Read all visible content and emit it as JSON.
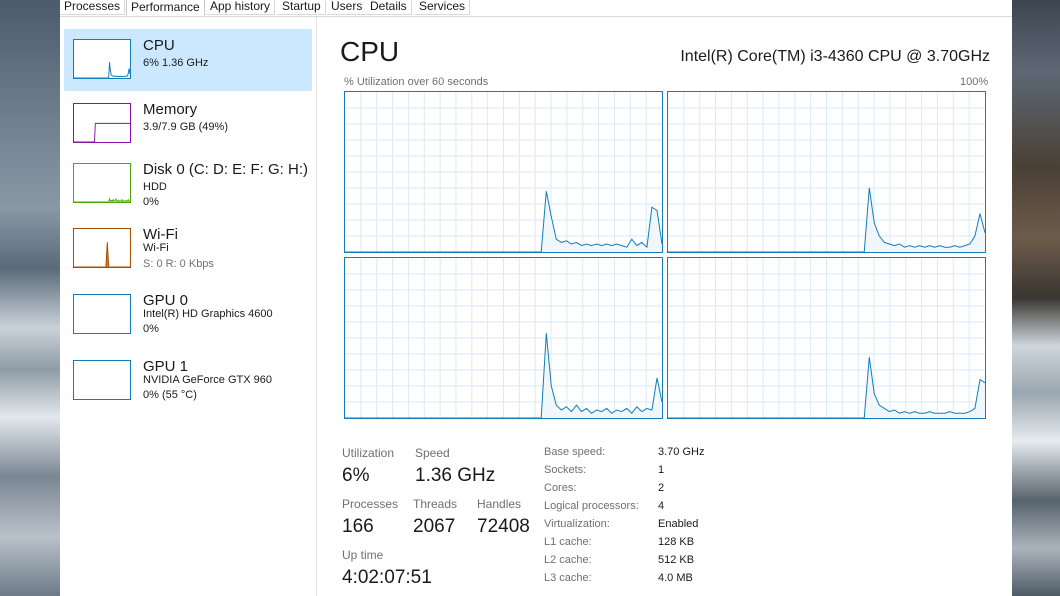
{
  "tabs": [
    "Processes",
    "Performance",
    "App history",
    "Startup",
    "Users",
    "Details",
    "Services"
  ],
  "sidebar": {
    "items": [
      {
        "title": "CPU",
        "line1": "6% 1.36 GHz",
        "line2": "",
        "color": "#117dbb"
      },
      {
        "title": "Memory",
        "line1": "3.9/7.9 GB (49%)",
        "line2": "",
        "color": "#8b12ae"
      },
      {
        "title": "Disk 0 (C: D: E: F: G: H:)",
        "line1": "HDD",
        "line2": "0%",
        "color": "#4da60c"
      },
      {
        "title": "Wi-Fi",
        "line1": "Wi-Fi",
        "line2": "S: 0 R: 0 Kbps",
        "color": "#a74f01"
      },
      {
        "title": "GPU 0",
        "line1": "Intel(R) HD Graphics 4600",
        "line2": "0%",
        "color": "#117dbb"
      },
      {
        "title": "GPU 1",
        "line1": "NVIDIA GeForce GTX 960",
        "line2": "0% (55 °C)",
        "color": "#117dbb"
      }
    ]
  },
  "main": {
    "title": "CPU",
    "cpu_model": "Intel(R) Core(TM) i3-4360 CPU @ 3.70GHz",
    "graph_label": "% Utilization over 60 seconds",
    "graph_max": "100%",
    "graph_color": "#117dbb"
  },
  "stats": {
    "utilization_label": "Utilization",
    "utilization_value": "6%",
    "speed_label": "Speed",
    "speed_value": "1.36 GHz",
    "processes_label": "Processes",
    "processes_value": "166",
    "threads_label": "Threads",
    "threads_value": "2067",
    "handles_label": "Handles",
    "handles_value": "72408",
    "uptime_label": "Up time",
    "uptime_value": "4:02:07:51"
  },
  "specs": [
    {
      "label": "Base speed:",
      "value": "3.70 GHz"
    },
    {
      "label": "Sockets:",
      "value": "1"
    },
    {
      "label": "Cores:",
      "value": "2"
    },
    {
      "label": "Logical processors:",
      "value": "4"
    },
    {
      "label": "Virtualization:",
      "value": "Enabled"
    },
    {
      "label": "L1 cache:",
      "value": "128 KB"
    },
    {
      "label": "L2 cache:",
      "value": "512 KB"
    },
    {
      "label": "L3 cache:",
      "value": "4.0 MB"
    }
  ],
  "core_utilization": [
    [
      0,
      0,
      0,
      0,
      0,
      0,
      0,
      0,
      0,
      0,
      0,
      0,
      0,
      0,
      0,
      0,
      0,
      0,
      0,
      0,
      0,
      0,
      0,
      0,
      0,
      0,
      0,
      0,
      0,
      0,
      0,
      0,
      0,
      0,
      0,
      0,
      0,
      0,
      0,
      0,
      38,
      22,
      8,
      6,
      7,
      5,
      6,
      4,
      5,
      4,
      5,
      4,
      5,
      4,
      5,
      4,
      3,
      8,
      4,
      6,
      3,
      28,
      26,
      5
    ],
    [
      0,
      0,
      0,
      0,
      0,
      0,
      0,
      0,
      0,
      0,
      0,
      0,
      0,
      0,
      0,
      0,
      0,
      0,
      0,
      0,
      0,
      0,
      0,
      0,
      0,
      0,
      0,
      0,
      0,
      0,
      0,
      0,
      0,
      0,
      0,
      0,
      0,
      0,
      0,
      0,
      40,
      18,
      10,
      6,
      5,
      4,
      5,
      3,
      4,
      3,
      4,
      3,
      4,
      3,
      4,
      3,
      3,
      4,
      3,
      4,
      5,
      10,
      24,
      12
    ],
    [
      0,
      0,
      0,
      0,
      0,
      0,
      0,
      0,
      0,
      0,
      0,
      0,
      0,
      0,
      0,
      0,
      0,
      0,
      0,
      0,
      0,
      0,
      0,
      0,
      0,
      0,
      0,
      0,
      0,
      0,
      0,
      0,
      0,
      0,
      0,
      0,
      0,
      0,
      0,
      0,
      53,
      20,
      8,
      5,
      7,
      4,
      8,
      4,
      6,
      3,
      5,
      4,
      6,
      3,
      5,
      4,
      6,
      3,
      7,
      4,
      6,
      5,
      25,
      10
    ],
    [
      0,
      0,
      0,
      0,
      0,
      0,
      0,
      0,
      0,
      0,
      0,
      0,
      0,
      0,
      0,
      0,
      0,
      0,
      0,
      0,
      0,
      0,
      0,
      0,
      0,
      0,
      0,
      0,
      0,
      0,
      0,
      0,
      0,
      0,
      0,
      0,
      0,
      0,
      0,
      0,
      38,
      15,
      8,
      6,
      4,
      5,
      3,
      4,
      3,
      4,
      3,
      3,
      4,
      3,
      3,
      3,
      4,
      3,
      3,
      3,
      4,
      6,
      24,
      22
    ]
  ],
  "thumb_data": {
    "cpu": [
      0,
      0,
      0,
      0,
      0,
      0,
      0,
      0,
      0,
      0,
      0,
      0,
      0,
      0,
      0,
      0,
      0,
      0,
      0,
      0,
      0,
      0,
      0,
      0,
      0,
      0,
      0,
      0,
      0,
      0,
      0,
      0,
      0,
      0,
      0,
      0,
      0,
      0,
      0,
      0,
      42,
      18,
      8,
      6,
      5,
      4,
      5,
      4,
      5,
      4,
      4,
      4,
      5,
      4,
      4,
      4,
      4,
      5,
      4,
      5,
      5,
      12,
      25,
      10
    ],
    "memory": [
      0,
      0,
      0,
      0,
      0,
      0,
      0,
      0,
      0,
      0,
      0,
      0,
      0,
      0,
      0,
      0,
      0,
      0,
      0,
      0,
      0,
      0,
      0,
      0,
      49,
      49,
      49,
      49,
      49,
      49,
      49,
      49,
      49,
      49,
      49,
      49,
      49,
      49,
      49,
      49,
      49,
      49,
      49,
      49,
      49,
      49,
      49,
      49,
      49,
      49,
      49,
      49,
      49,
      49,
      49,
      49,
      49,
      49,
      49,
      49,
      49,
      49,
      49,
      49
    ],
    "disk": [
      0,
      0,
      0,
      0,
      0,
      0,
      0,
      0,
      0,
      0,
      0,
      0,
      0,
      0,
      0,
      0,
      0,
      0,
      0,
      0,
      0,
      0,
      0,
      0,
      0,
      0,
      0,
      0,
      0,
      0,
      0,
      0,
      0,
      0,
      0,
      0,
      0,
      0,
      0,
      0,
      8,
      2,
      4,
      1,
      6,
      2,
      3,
      8,
      1,
      2,
      5,
      1,
      3,
      2,
      6,
      1,
      2,
      4,
      1,
      3,
      2,
      6,
      1,
      2
    ],
    "wifi": [
      0,
      0,
      0,
      0,
      0,
      0,
      0,
      0,
      0,
      0,
      0,
      0,
      0,
      0,
      0,
      0,
      0,
      0,
      0,
      0,
      0,
      0,
      0,
      0,
      0,
      0,
      0,
      0,
      0,
      0,
      0,
      0,
      0,
      0,
      0,
      0,
      0,
      0,
      0,
      0,
      0,
      0,
      0,
      0,
      0,
      0,
      0,
      0,
      0,
      0,
      0,
      0,
      0,
      0,
      0,
      0,
      0,
      0,
      0,
      0,
      0,
      0,
      0,
      0
    ]
  }
}
